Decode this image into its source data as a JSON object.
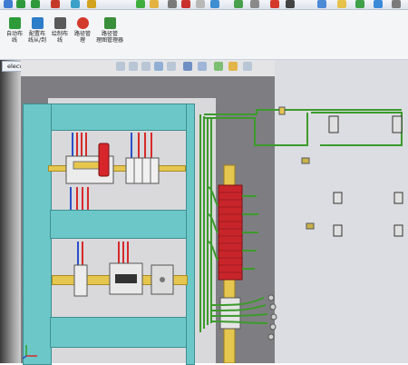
{
  "document": {
    "tab_title": "elecworks"
  },
  "ribbon": {
    "buttons": [
      {
        "label_lines": [
          "自动布",
          "线"
        ],
        "icon": "auto-route-icon",
        "color": "#2e9b3a"
      },
      {
        "label_lines": [
          "配置布",
          "线从/到"
        ],
        "icon": "configure-route-icon",
        "color": "#2e7dc9"
      },
      {
        "label_lines": [
          "绘制布",
          "线"
        ],
        "icon": "draw-route-icon",
        "color": "#5a5a5a"
      },
      {
        "label_lines": [
          "路径管",
          "理"
        ],
        "icon": "route-manage-icon",
        "color": "#d33a2c"
      },
      {
        "label_lines": [
          "路径管",
          "理图管理器"
        ],
        "icon": "route-manager-icon",
        "color": "#3a8f3a"
      }
    ]
  },
  "colors": {
    "teal_frame": "#6cc7c8",
    "din_rail": "#e5c64e",
    "wire_green": "#3d9a2c",
    "wire_red": "#d62a2a",
    "wire_blue": "#2a4fc9",
    "cabinet_grey": "#7e7e82"
  }
}
